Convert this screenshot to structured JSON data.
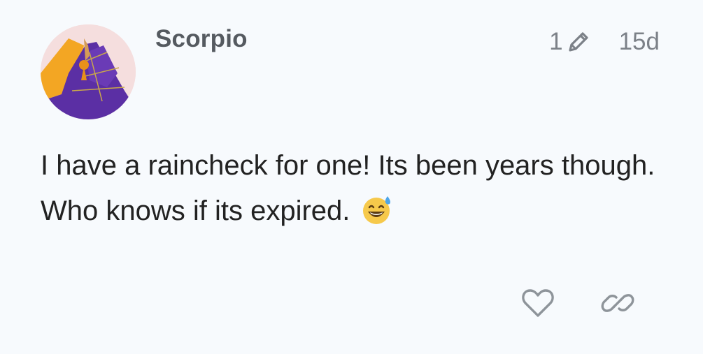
{
  "post": {
    "author": {
      "username": "Scorpio"
    },
    "meta": {
      "edit_count": "1",
      "edit_icon": "pencil-icon",
      "date": "15d"
    },
    "body": {
      "text": "I have a raincheck for one! Its been years though. Who knows if its expired.",
      "emoji": "sweat-smile-emoji"
    },
    "actions": {
      "like_icon": "heart-icon",
      "share_icon": "link-icon"
    }
  },
  "colors": {
    "background": "#f7fafd",
    "username": "#555a60",
    "meta_text": "#7c8188",
    "body_text": "#222222",
    "icon": "#8e949a"
  }
}
